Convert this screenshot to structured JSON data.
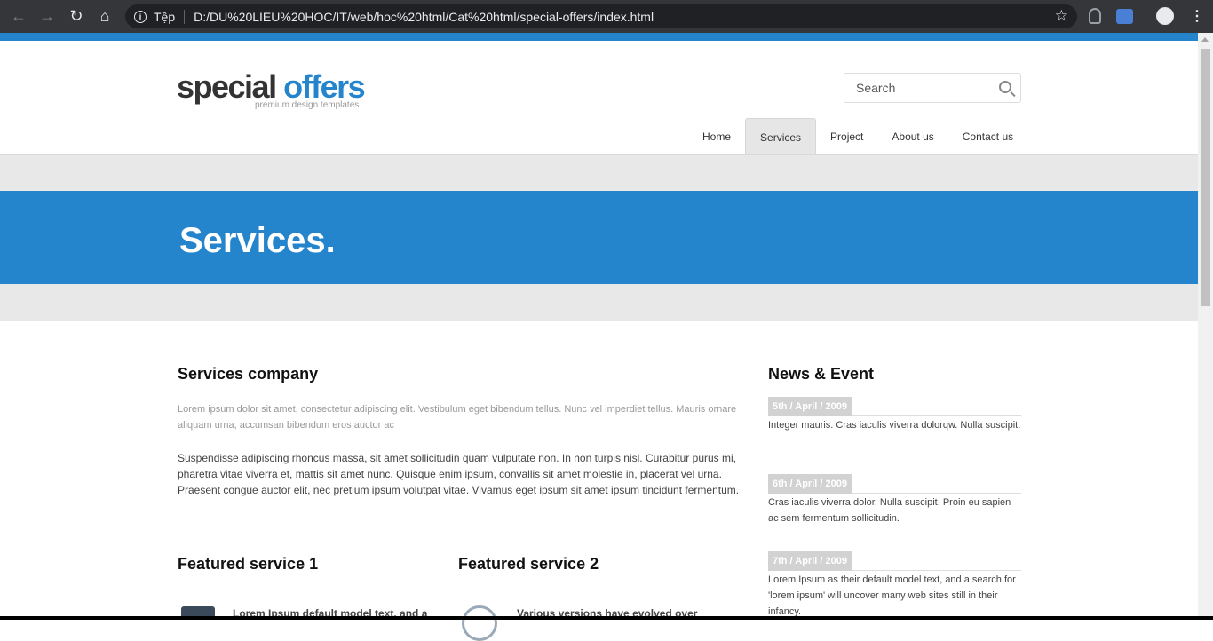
{
  "browser": {
    "site_label": "Tệp",
    "url": "D:/DU%20LIEU%20HOC/IT/web/hoc%20html/Cat%20html/special-offers/index.html",
    "icons": [
      "back-arrow-icon",
      "forward-arrow-icon",
      "reload-icon",
      "home-icon",
      "info-icon",
      "star-icon",
      "extension-icon",
      "translate-icon",
      "profile-icon",
      "more-icon"
    ]
  },
  "logo": {
    "word1": "special",
    "word2": "offers",
    "tagline": "premium design templates"
  },
  "search": {
    "placeholder": "Search"
  },
  "menu": [
    {
      "label": "Home"
    },
    {
      "label": "Services"
    },
    {
      "label": "Project"
    },
    {
      "label": "About us"
    },
    {
      "label": "Contact us"
    }
  ],
  "banner": {
    "title": "Services."
  },
  "main": {
    "heading": "Services company",
    "intro": "Lorem ipsum dolor sit amet, consectetur adipiscing elit. Vestibulum eget bibendum tellus. Nunc vel imperdiet tellus. Mauris ornare aliquam urna, accumsan bibendum eros auctor ac",
    "body": "Suspendisse adipiscing rhoncus massa, sit amet sollicitudin quam vulputate non. In non turpis nisl. Curabitur purus mi, pharetra vitae viverra et, mattis sit amet nunc. Quisque enim ipsum, convallis sit amet molestie in, placerat vel urna. Praesent congue auctor elit, nec pretium ipsum volutpat vitae. Vivamus eget ipsum sit amet ipsum tincidunt fermentum."
  },
  "news": {
    "heading": "News & Event",
    "items": [
      {
        "date": "5th / April / 2009",
        "text": "Integer mauris. Cras iaculis viverra dolorqw. Nulla suscipit."
      },
      {
        "date": "6th / April / 2009",
        "text": "Cras iaculis viverra dolor. Nulla suscipit. Proin eu sapien ac sem fermentum sollicitudin."
      },
      {
        "date": "7th / April / 2009",
        "text": "Lorem Ipsum as their default model text, and a search for 'lorem ipsum' will uncover many web sites still in their infancy."
      }
    ]
  },
  "featured": [
    {
      "heading": "Featured service 1",
      "text": "Lorem Ipsum default model text, and a"
    },
    {
      "heading": "Featured service 2",
      "text": "Various versions have evolved over"
    }
  ],
  "colors": {
    "accent": "#2585cc",
    "band": "#e8e8e8"
  }
}
